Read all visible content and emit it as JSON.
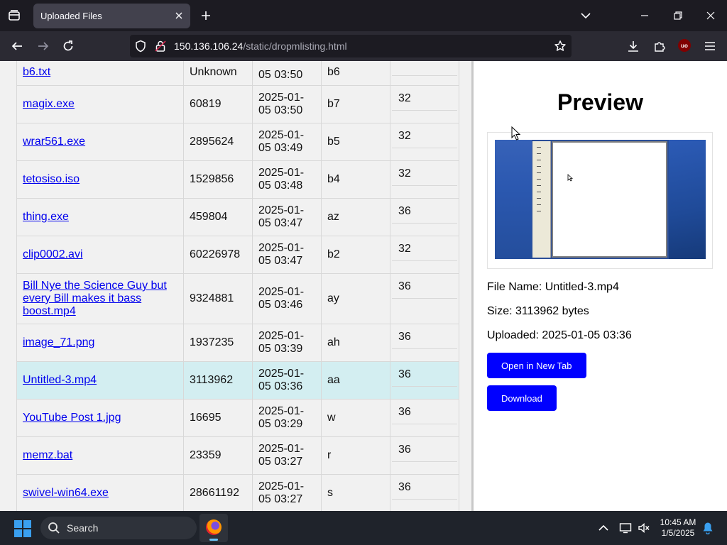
{
  "browser": {
    "tab_title": "Uploaded Files",
    "url_host": "150.136.106.24",
    "url_path": "/static/dropmlisting.html"
  },
  "files": [
    {
      "name": "b6.txt",
      "size": "Unknown",
      "date1": "",
      "date2": "05 03:50",
      "id": "b6",
      "count": ""
    },
    {
      "name": "magix.exe",
      "size": "60819",
      "date1": "2025-01-",
      "date2": "05 03:50",
      "id": "b7",
      "count": "32"
    },
    {
      "name": "wrar561.exe",
      "size": "2895624",
      "date1": "2025-01-",
      "date2": "05 03:49",
      "id": "b5",
      "count": "32"
    },
    {
      "name": "tetosiso.iso",
      "size": "1529856",
      "date1": "2025-01-",
      "date2": "05 03:48",
      "id": "b4",
      "count": "32"
    },
    {
      "name": "thing.exe",
      "size": "459804",
      "date1": "2025-01-",
      "date2": "05 03:47",
      "id": "az",
      "count": "36"
    },
    {
      "name": "clip0002.avi",
      "size": "60226978",
      "date1": "2025-01-",
      "date2": "05 03:47",
      "id": "b2",
      "count": "32"
    },
    {
      "name": "Bill Nye the Science Guy but every Bill makes it bass boost.mp4",
      "size": "9324881",
      "date1": "2025-01-",
      "date2": "05 03:46",
      "id": "ay",
      "count": "36"
    },
    {
      "name": "image_71.png",
      "size": "1937235",
      "date1": "2025-01-",
      "date2": "05 03:39",
      "id": "ah",
      "count": "36"
    },
    {
      "name": "Untitled-3.mp4",
      "size": "3113962",
      "date1": "2025-01-",
      "date2": "05 03:36",
      "id": "aa",
      "count": "36",
      "selected": true
    },
    {
      "name": "YouTube Post 1.jpg",
      "size": "16695",
      "date1": "2025-01-",
      "date2": "05 03:29",
      "id": "w",
      "count": "36"
    },
    {
      "name": "memz.bat",
      "size": "23359",
      "date1": "2025-01-",
      "date2": "05 03:27",
      "id": "r",
      "count": "36"
    },
    {
      "name": "swivel-win64.exe",
      "size": "28661192",
      "date1": "2025-01-",
      "date2": "05 03:27",
      "id": "s",
      "count": "36"
    }
  ],
  "preview": {
    "heading": "Preview",
    "file_name": "File Name: Untitled-3.mp4",
    "size": "Size: 3113962 bytes",
    "uploaded": "Uploaded: 2025-01-05 03:36",
    "open_button": "Open in New Tab",
    "download_button": "Download"
  },
  "taskbar": {
    "search_label": "Search",
    "time": "10:45 AM",
    "date": "1/5/2025"
  },
  "extension_badge": "uo",
  "colors": {
    "link": "#0000ee",
    "button": "#0000ff",
    "selected_row": "#d3eef1"
  }
}
